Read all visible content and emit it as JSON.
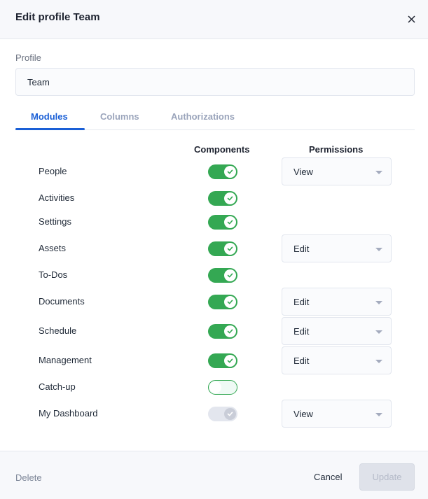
{
  "header": {
    "title": "Edit profile Team",
    "close_icon": "close-icon"
  },
  "profile": {
    "label": "Profile",
    "value": "Team",
    "placeholder": ""
  },
  "tabs": [
    {
      "label": "Modules",
      "active": true
    },
    {
      "label": "Columns",
      "active": false
    },
    {
      "label": "Authorizations",
      "active": false
    }
  ],
  "table": {
    "components_header": "Components",
    "permissions_header": "Permissions",
    "rows": [
      {
        "name": "People",
        "state": "on",
        "permission": "View"
      },
      {
        "name": "Activities",
        "state": "on",
        "permission": null
      },
      {
        "name": "Settings",
        "state": "on",
        "permission": null
      },
      {
        "name": "Assets",
        "state": "on",
        "permission": "Edit"
      },
      {
        "name": "To-Dos",
        "state": "on",
        "permission": null
      },
      {
        "name": "Documents",
        "state": "on",
        "permission": "Edit"
      },
      {
        "name": "Schedule",
        "state": "on",
        "permission": "Edit"
      },
      {
        "name": "Management",
        "state": "on",
        "permission": "Edit"
      },
      {
        "name": "Catch-up",
        "state": "off",
        "permission": null
      },
      {
        "name": "My Dashboard",
        "state": "disabled",
        "permission": "View"
      }
    ]
  },
  "footer": {
    "delete_label": "Delete",
    "cancel_label": "Cancel",
    "update_label": "Update"
  },
  "colors": {
    "accent": "#1a5fd6",
    "toggle_on": "#34a853"
  }
}
